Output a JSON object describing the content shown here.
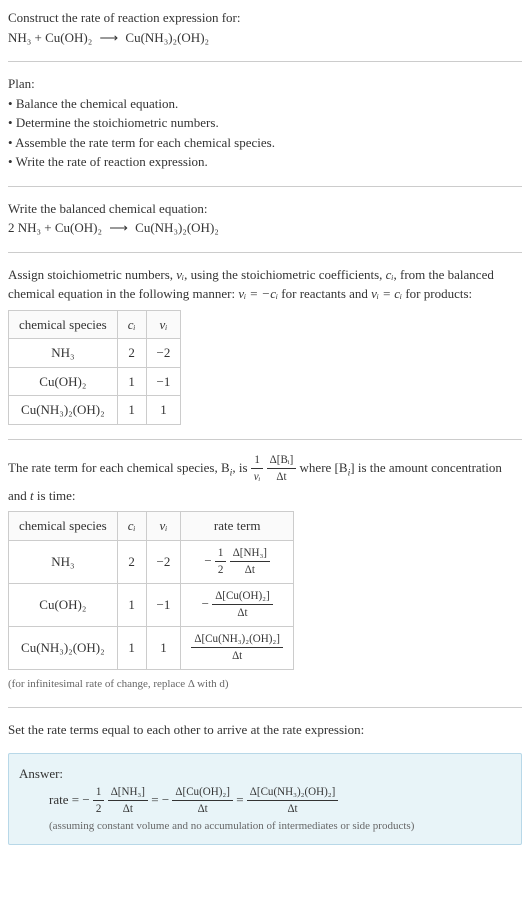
{
  "header": {
    "prompt": "Construct the rate of reaction expression for:",
    "equation_lhs": "NH₃ + Cu(OH)₂",
    "equation_arrow": "⟶",
    "equation_rhs": "Cu(NH₃)₂(OH)₂"
  },
  "plan": {
    "title": "Plan:",
    "steps": [
      "Balance the chemical equation.",
      "Determine the stoichiometric numbers.",
      "Assemble the rate term for each chemical species.",
      "Write the rate of reaction expression."
    ]
  },
  "balanced": {
    "title": "Write the balanced chemical equation:",
    "equation_lhs": "2 NH₃ + Cu(OH)₂",
    "equation_arrow": "⟶",
    "equation_rhs": "Cu(NH₃)₂(OH)₂"
  },
  "assign": {
    "text_before_nu": "Assign stoichiometric numbers, ",
    "nu_i": "νᵢ",
    "text_mid1": ", using the stoichiometric coefficients, ",
    "c_i": "cᵢ",
    "text_mid2": ", from the balanced chemical equation in the following manner: ",
    "rule_reactants": "νᵢ = −cᵢ",
    "text_mid3": " for reactants and ",
    "rule_products": "νᵢ = cᵢ",
    "text_after": " for products:",
    "table": {
      "headers": [
        "chemical species",
        "cᵢ",
        "νᵢ"
      ],
      "rows": [
        [
          "NH₃",
          "2",
          "−2"
        ],
        [
          "Cu(OH)₂",
          "1",
          "−1"
        ],
        [
          "Cu(NH₃)₂(OH)₂",
          "1",
          "1"
        ]
      ]
    }
  },
  "rateterm": {
    "text1": "The rate term for each chemical species, B",
    "sub_i": "i",
    "text2": ", is ",
    "frac1_num": "1",
    "frac1_den": "νᵢ",
    "frac2_num": "Δ[Bᵢ]",
    "frac2_den": "Δt",
    "text3": " where [B",
    "text4": "] is the amount concentration and ",
    "t_var": "t",
    "text5": " is time:",
    "table": {
      "headers": [
        "chemical species",
        "cᵢ",
        "νᵢ",
        "rate term"
      ],
      "rows": [
        {
          "species": "NH₃",
          "c": "2",
          "nu": "−2",
          "coef_num": "1",
          "coef_den": "2",
          "sign": "−",
          "delta_num": "Δ[NH₃]",
          "delta_den": "Δt"
        },
        {
          "species": "Cu(OH)₂",
          "c": "1",
          "nu": "−1",
          "coef_num": "",
          "coef_den": "",
          "sign": "−",
          "delta_num": "Δ[Cu(OH)₂]",
          "delta_den": "Δt"
        },
        {
          "species": "Cu(NH₃)₂(OH)₂",
          "c": "1",
          "nu": "1",
          "coef_num": "",
          "coef_den": "",
          "sign": "",
          "delta_num": "Δ[Cu(NH₃)₂(OH)₂]",
          "delta_den": "Δt"
        }
      ]
    },
    "note": "(for infinitesimal rate of change, replace Δ with d)"
  },
  "final": {
    "title": "Set the rate terms equal to each other to arrive at the rate expression:"
  },
  "answer": {
    "label": "Answer:",
    "rate_label": "rate = ",
    "term1_sign": "−",
    "term1_coef_num": "1",
    "term1_coef_den": "2",
    "term1_num": "Δ[NH₃]",
    "term1_den": "Δt",
    "eq1": " = ",
    "term2_sign": "−",
    "term2_num": "Δ[Cu(OH)₂]",
    "term2_den": "Δt",
    "eq2": " = ",
    "term3_num": "Δ[Cu(NH₃)₂(OH)₂]",
    "term3_den": "Δt",
    "assumption": "(assuming constant volume and no accumulation of intermediates or side products)"
  }
}
